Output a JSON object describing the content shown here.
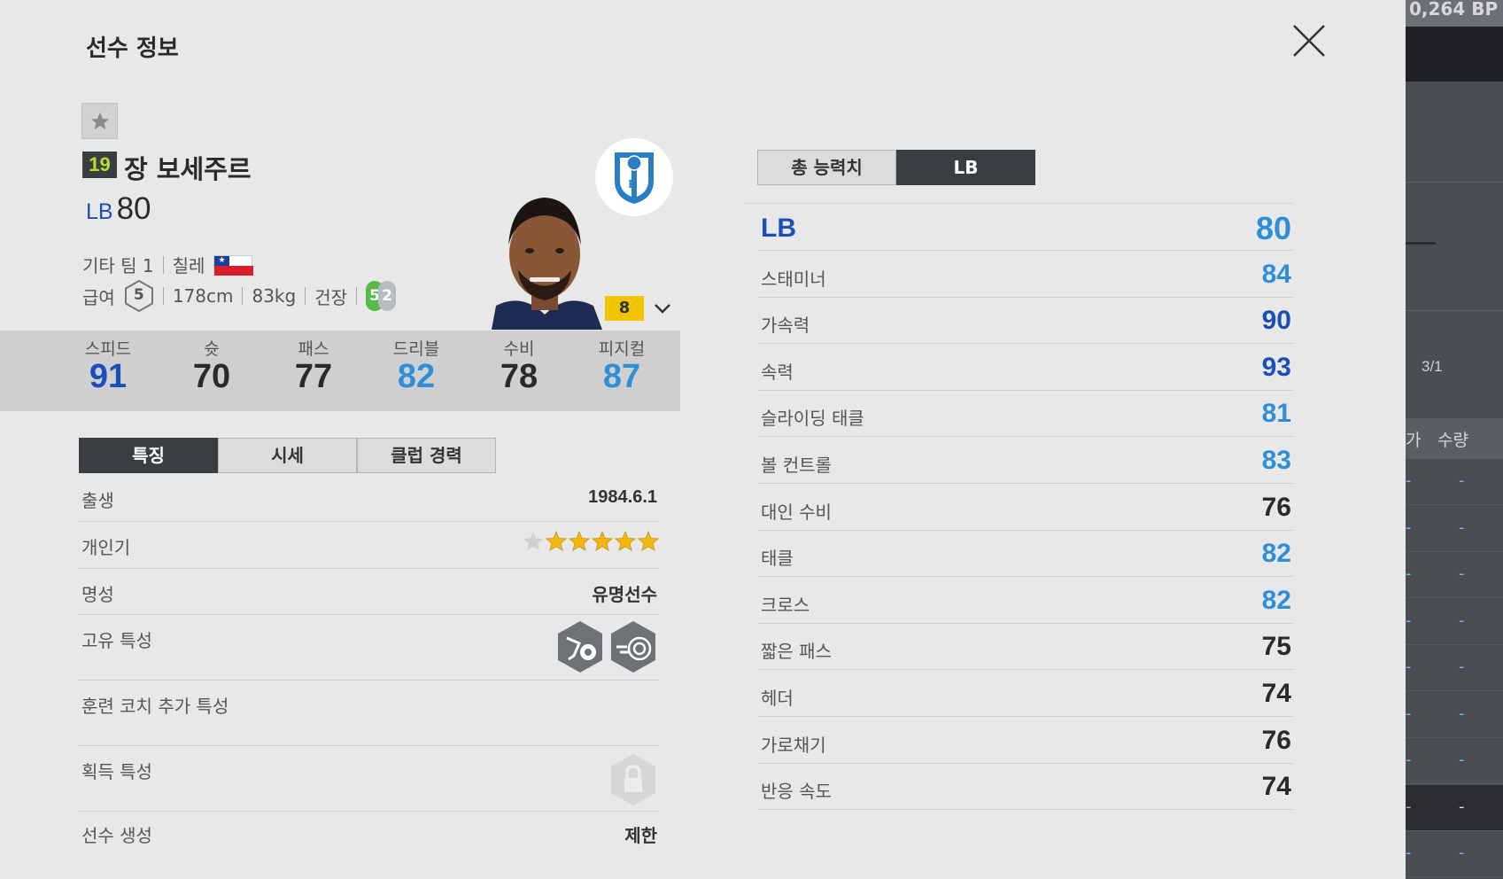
{
  "modal": {
    "title": "선수 정보"
  },
  "player": {
    "grade": "19",
    "name": "장 보세주르",
    "position": "LB",
    "ovr": "80",
    "team": "기타 팀 1",
    "nation": "칠레",
    "wage_label": "급여",
    "wage": "5",
    "height": "178cm",
    "weight": "83kg",
    "build": "건장",
    "left_foot": "5",
    "right_foot": "2",
    "level": "8"
  },
  "summary_stats": [
    {
      "label": "스피드",
      "value": "91",
      "color": "#1b4fb8"
    },
    {
      "label": "슛",
      "value": "70",
      "color": "#2a2a2a"
    },
    {
      "label": "패스",
      "value": "77",
      "color": "#2a2a2a"
    },
    {
      "label": "드리블",
      "value": "82",
      "color": "#2e8fd6"
    },
    {
      "label": "수비",
      "value": "78",
      "color": "#2a2a2a"
    },
    {
      "label": "피지컬",
      "value": "87",
      "color": "#2e8fd6"
    }
  ],
  "left_tabs": [
    "특징",
    "시세",
    "클럽 경력"
  ],
  "details": {
    "birth_label": "출생",
    "birth": "1984.6.1",
    "popularity_label": "개인기",
    "popularity_stars": 5,
    "popularity_max": 6,
    "reputation_label": "명성",
    "reputation": "유명선수",
    "unique_label": "고유 특성",
    "coach_label": "훈련 코치 추가 특성",
    "acquired_label": "획득 특성",
    "create_label": "선수 생성",
    "create": "제한"
  },
  "right_tabs": [
    "총 능력치",
    "LB"
  ],
  "attributes": [
    {
      "label": "LB",
      "value": "80",
      "color": "#2e8fd6",
      "main": true
    },
    {
      "label": "스태미너",
      "value": "84",
      "color": "#2e8fd6"
    },
    {
      "label": "가속력",
      "value": "90",
      "color": "#1b4fb8"
    },
    {
      "label": "속력",
      "value": "93",
      "color": "#1b4fb8"
    },
    {
      "label": "슬라이딩 태클",
      "value": "81",
      "color": "#2e8fd6"
    },
    {
      "label": "볼 컨트롤",
      "value": "83",
      "color": "#2e8fd6"
    },
    {
      "label": "대인 수비",
      "value": "76",
      "color": "#2a2a2a"
    },
    {
      "label": "태클",
      "value": "82",
      "color": "#2e8fd6"
    },
    {
      "label": "크로스",
      "value": "82",
      "color": "#2e8fd6"
    },
    {
      "label": "짧은 패스",
      "value": "75",
      "color": "#2a2a2a"
    },
    {
      "label": "헤더",
      "value": "74",
      "color": "#2a2a2a"
    },
    {
      "label": "가로채기",
      "value": "76",
      "color": "#2a2a2a"
    },
    {
      "label": "반응 속도",
      "value": "74",
      "color": "#2a2a2a"
    }
  ],
  "background": {
    "top_text": "0,264 BP",
    "page": "3/1",
    "qty_header": "수량",
    "cut_header": "가",
    "row_dash": "-"
  }
}
